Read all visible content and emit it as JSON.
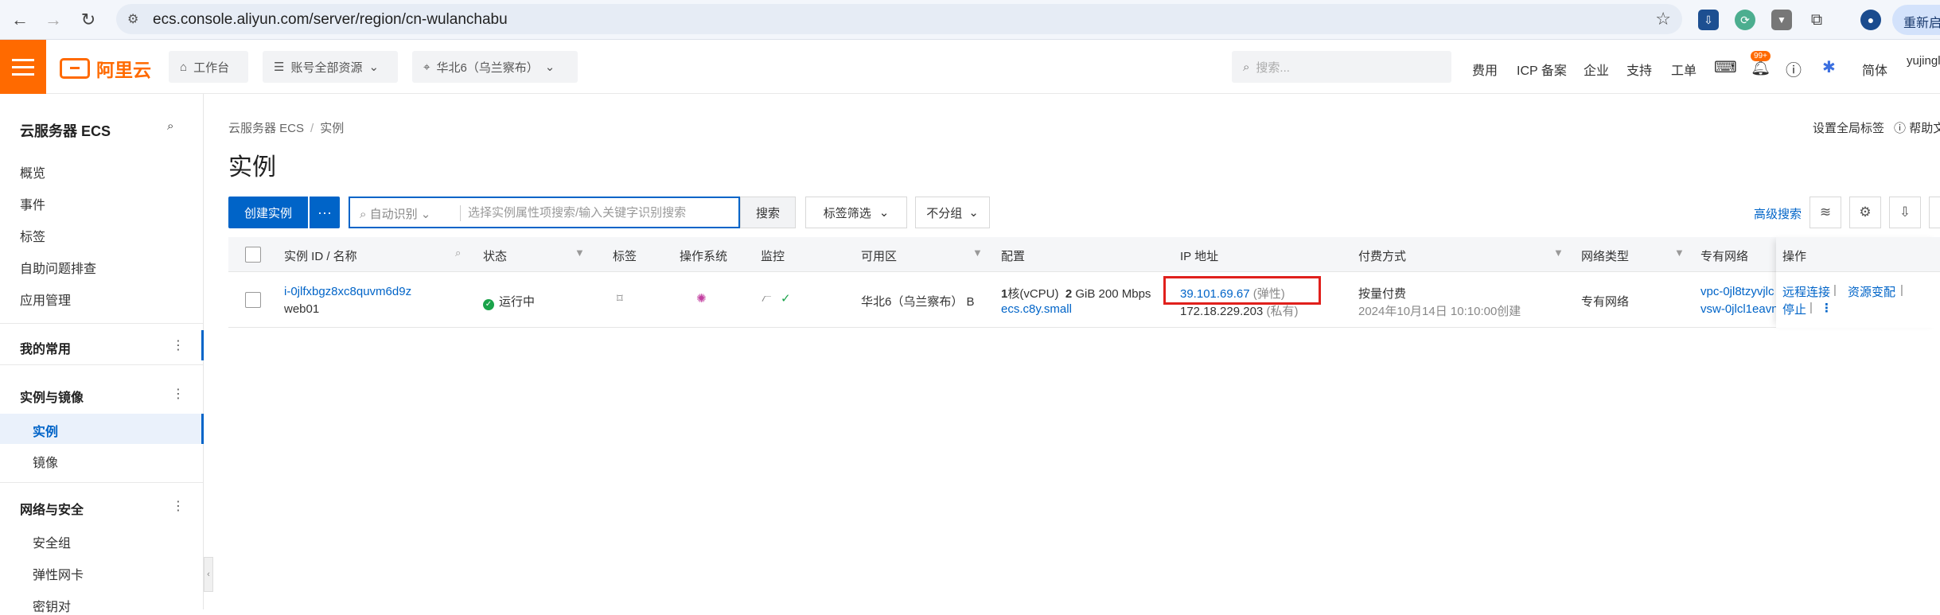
{
  "browser": {
    "url": "ecs.console.aliyun.com/server/region/cn-wulanchabu",
    "restart_label": "重新启"
  },
  "topnav": {
    "logo_text": "阿里云",
    "workbench": "工作台",
    "resource_scope": "账号全部资源",
    "region": "华北6（乌兰察布）",
    "search_placeholder": "搜索...",
    "links": [
      "费用",
      "ICP 备案",
      "企业",
      "支持",
      "工单"
    ],
    "badge": "99+",
    "lang": "简体",
    "user": "yujingl"
  },
  "sidebar": {
    "title": "云服务器 ECS",
    "items_top": [
      "概览",
      "事件",
      "标签",
      "自助问题排查",
      "应用管理"
    ],
    "group_favorites": "我的常用",
    "group_instances": "实例与镜像",
    "instances_items": [
      "实例",
      "镜像"
    ],
    "group_network": "网络与安全",
    "network_items": [
      "安全组",
      "弹性网卡",
      "密钥对"
    ]
  },
  "breadcrumb": {
    "root": "云服务器 ECS",
    "sep": "/",
    "current": "实例"
  },
  "page_title": "实例",
  "header_links": {
    "global_tag": "设置全局标签",
    "help": "帮助文"
  },
  "toolbar": {
    "create_label": "创建实例",
    "more_label": "···",
    "filter_mode": "自动识别",
    "search_placeholder": "选择实例属性项搜索/输入关键字识别搜索",
    "search_label": "搜索",
    "tag_filter": "标签筛选",
    "group_select": "不分组",
    "advanced_search": "高级搜索"
  },
  "table": {
    "columns": [
      "实例 ID / 名称",
      "状态",
      "标签",
      "操作系统",
      "监控",
      "可用区",
      "配置",
      "IP 地址",
      "付费方式",
      "网络类型",
      "专有网络",
      "操作"
    ],
    "row": {
      "instance_id": "i-0jlfxbgz8xc8quvm6d9z",
      "instance_name": "web01",
      "status": "运行中",
      "zone": "华北6（乌兰察布） B",
      "config_cpu_num": "1",
      "config_cpu_unit": "核(vCPU)",
      "config_mem_num": "2",
      "config_mem_unit": "GiB 200 Mbps",
      "instance_type": "ecs.c8y.small",
      "public_ip": "39.101.69.67",
      "public_ip_tag": "(弹性)",
      "private_ip": "172.18.229.203",
      "private_ip_tag": "(私有)",
      "billing": "按量付费",
      "created": "2024年10月14日 10:10:00创建",
      "network_type": "专有网络",
      "vpc": "vpc-0jl8tzyvjlc",
      "vsw": "vsw-0jlcl1eavn",
      "ops": {
        "remote": "远程连接",
        "resize": "资源变配",
        "stop": "停止"
      }
    }
  },
  "colors": {
    "brand": "#ff6a00",
    "primary": "#0064c8",
    "highlight": "#e0201c",
    "running": "#1aa34a"
  }
}
